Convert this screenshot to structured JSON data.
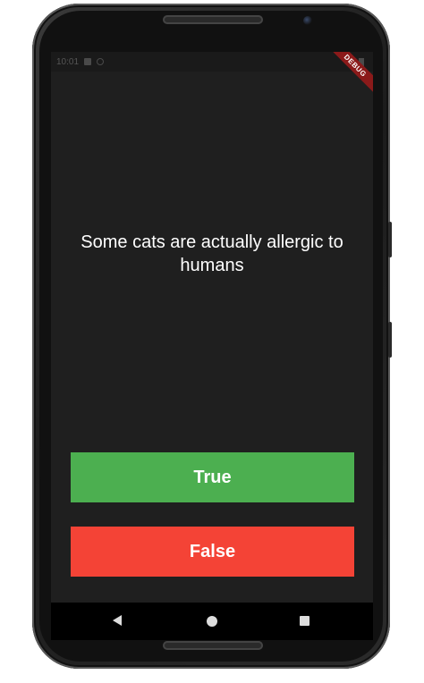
{
  "statusbar": {
    "time": "10:01"
  },
  "debug_banner": {
    "label": "DEBUG"
  },
  "quiz": {
    "question": "Some cats are actually allergic to humans"
  },
  "buttons": {
    "true_label": "True",
    "false_label": "False"
  },
  "colors": {
    "background": "#1f1f1f",
    "true_button": "#4caf50",
    "false_button": "#f44336",
    "text": "#ffffff",
    "debug_banner": "#8b1a1a"
  },
  "icons": {
    "nav_back": "back-triangle-icon",
    "nav_home": "home-circle-icon",
    "nav_recent": "recent-square-icon"
  }
}
